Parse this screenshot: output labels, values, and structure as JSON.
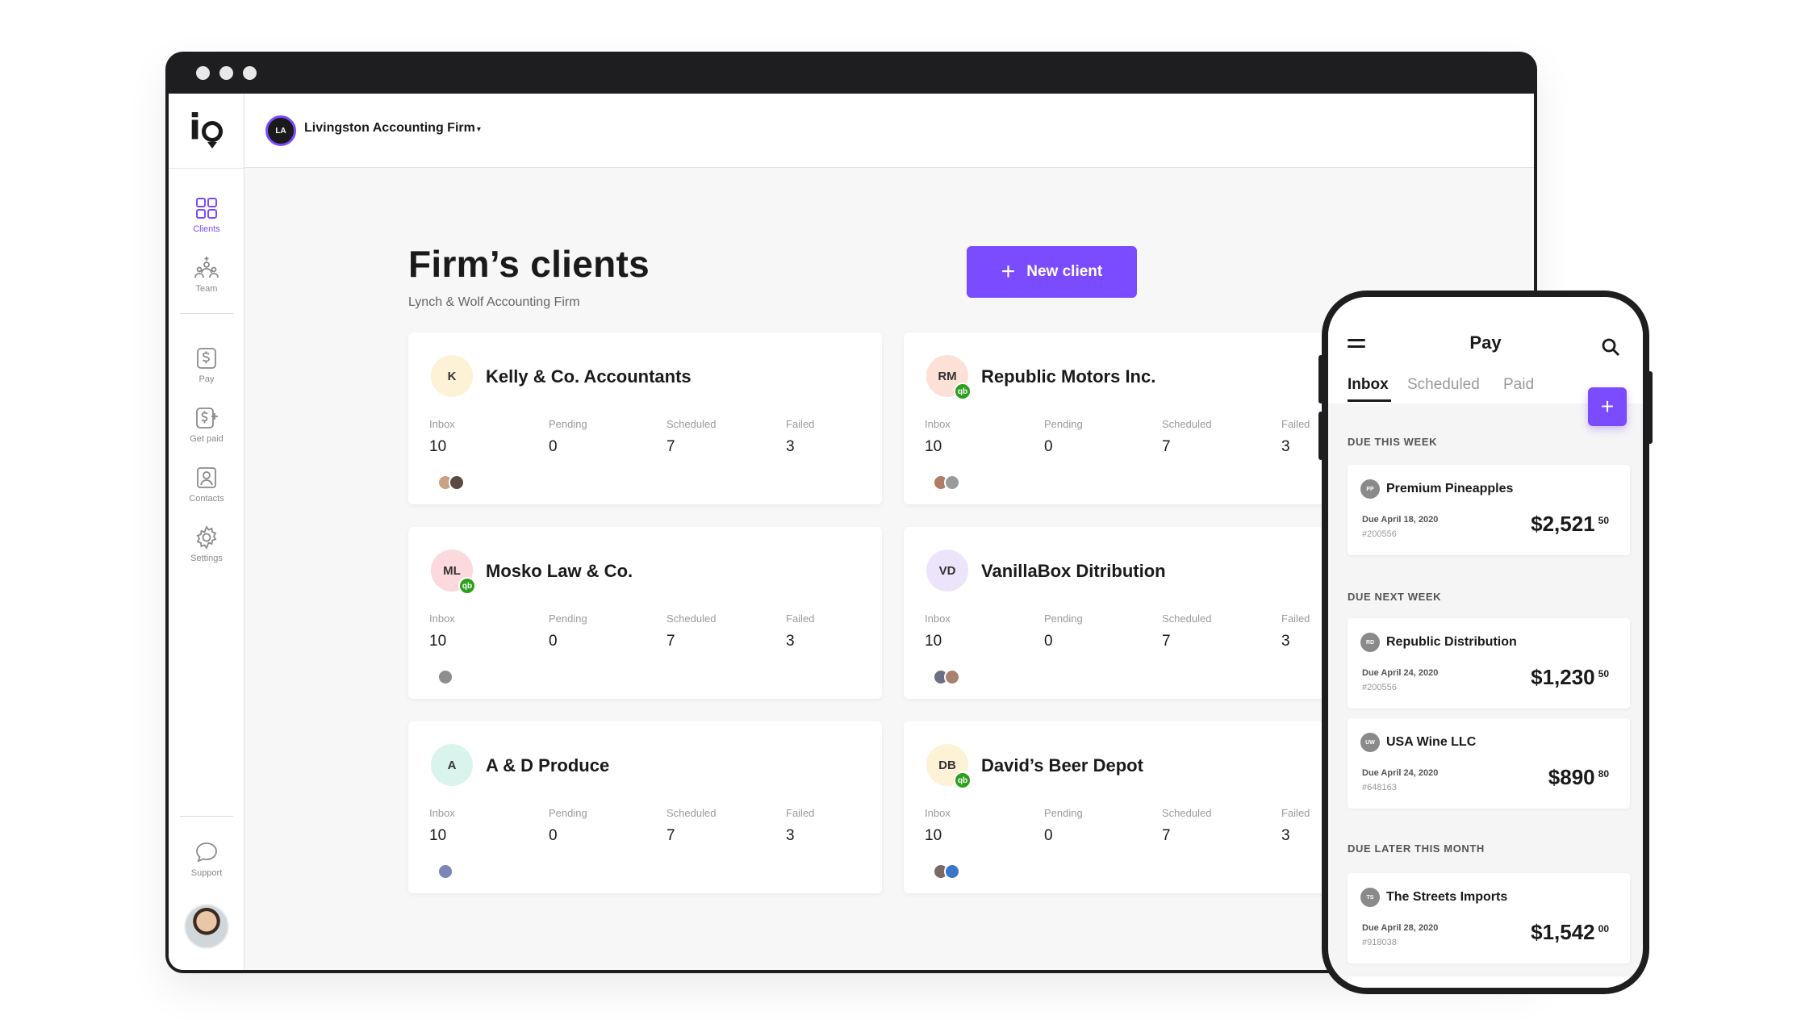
{
  "topbar": {
    "firm_initials": "LA",
    "firm_name": "Livingston Accounting Firm",
    "caret": "▾"
  },
  "sidebar": {
    "items": [
      {
        "label": "Clients",
        "icon": "grid-icon"
      },
      {
        "label": "Team",
        "icon": "team-icon"
      },
      {
        "label": "Pay",
        "icon": "pay-icon"
      },
      {
        "label": "Get paid",
        "icon": "get-paid-icon"
      },
      {
        "label": "Contacts",
        "icon": "contacts-icon"
      },
      {
        "label": "Settings",
        "icon": "gear-icon"
      },
      {
        "label": "Support",
        "icon": "chat-bubble-icon"
      }
    ]
  },
  "page": {
    "title": "Firm’s clients",
    "subtitle": "Lynch & Wolf Accounting Firm",
    "new_client_label": "New client",
    "plus": "+"
  },
  "stat_labels": {
    "inbox": "Inbox",
    "pending": "Pending",
    "scheduled": "Scheduled",
    "failed": "Failed"
  },
  "clients": [
    {
      "initials": "K",
      "name": "Kelly & Co. Accountants",
      "inbox": "10",
      "pending": "0",
      "scheduled": "7",
      "failed": "3",
      "qb": false,
      "color": "#fdf1d6"
    },
    {
      "initials": "RM",
      "name": "Republic Motors Inc.",
      "inbox": "10",
      "pending": "0",
      "scheduled": "7",
      "failed": "3",
      "qb": true,
      "color": "#fde0d6"
    },
    {
      "initials": "ML",
      "name": "Mosko Law & Co.",
      "inbox": "10",
      "pending": "0",
      "scheduled": "7",
      "failed": "3",
      "qb": true,
      "color": "#fbd9dc"
    },
    {
      "initials": "VD",
      "name": "VanillaBox Ditribution",
      "inbox": "10",
      "pending": "0",
      "scheduled": "7",
      "failed": "3",
      "qb": false,
      "color": "#ebe4fb"
    },
    {
      "initials": "A",
      "name": "A & D Produce",
      "inbox": "10",
      "pending": "0",
      "scheduled": "7",
      "failed": "3",
      "qb": false,
      "color": "#d9f4ec"
    },
    {
      "initials": "DB",
      "name": "David’s Beer Depot",
      "inbox": "10",
      "pending": "0",
      "scheduled": "7",
      "failed": "3",
      "qb": true,
      "color": "#fdf1d6"
    }
  ],
  "qb_label": "qb",
  "phone": {
    "title": "Pay",
    "tabs": [
      "Inbox",
      "Scheduled",
      "Paid"
    ],
    "fab": "+",
    "sections": [
      "DUE THIS WEEK",
      "DUE NEXT WEEK",
      "DUE LATER THIS MONTH"
    ],
    "bills": [
      {
        "initials": "PP",
        "name": "Premium Pineapples",
        "due": "Due April 18, 2020",
        "num": "#200556",
        "amount": "$2,521",
        "cents": "50"
      },
      {
        "initials": "RD",
        "name": "Republic Distribution",
        "due": "Due April 24, 2020",
        "num": "#200556",
        "amount": "$1,230",
        "cents": "50"
      },
      {
        "initials": "UW",
        "name": "USA Wine LLC",
        "due": "Due April 24, 2020",
        "num": "#648163",
        "amount": "$890",
        "cents": "80"
      },
      {
        "initials": "TS",
        "name": "The Streets Imports",
        "due": "Due April 28, 2020",
        "num": "#918038",
        "amount": "$1,542",
        "cents": "00"
      }
    ]
  },
  "colors": {
    "accent": "#7b4bff",
    "quickbooks": "#2ca01c",
    "dark": "#1e1e20"
  }
}
